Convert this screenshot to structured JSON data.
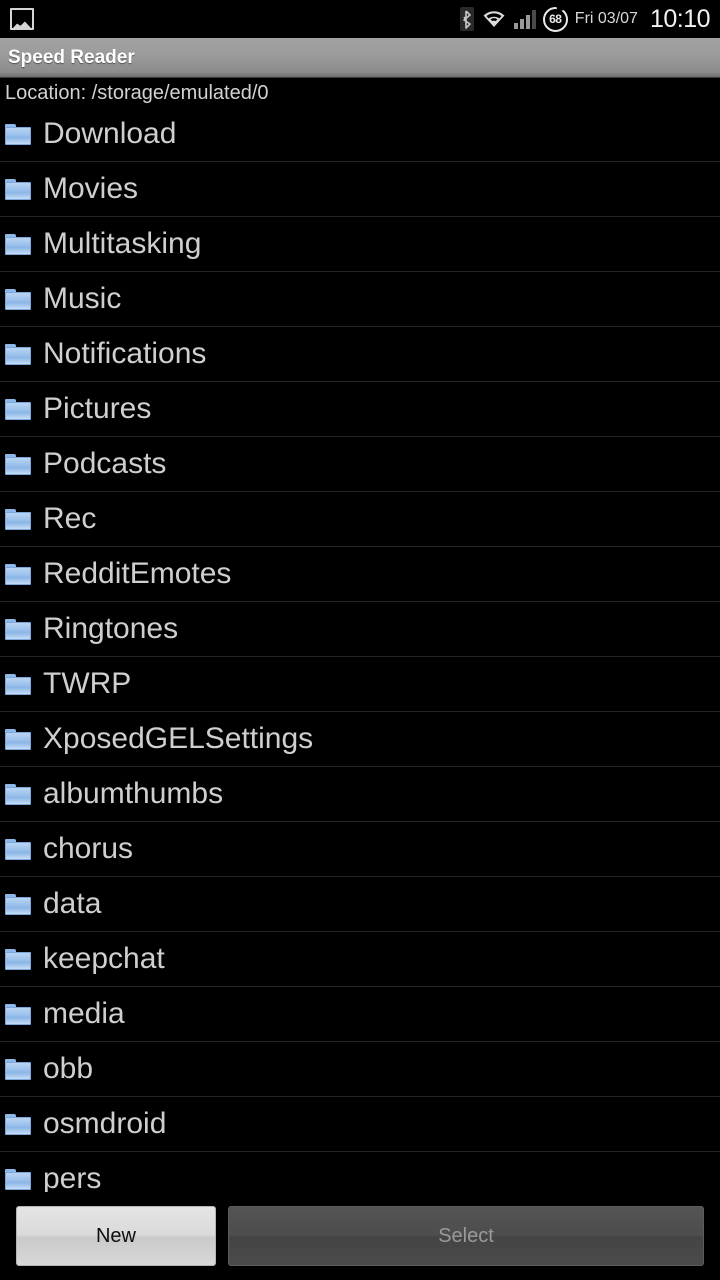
{
  "status_bar": {
    "notification_icon": "image-icon",
    "bluetooth_icon": "bluetooth-icon",
    "wifi_icon": "wifi-icon",
    "signal_icon": "cell-signal-icon",
    "battery_level": "68",
    "date": "Fri 03/07",
    "time": "10:10"
  },
  "title_bar": {
    "app_title": "Speed Reader"
  },
  "location": {
    "text": "Location: /storage/emulated/0"
  },
  "file_list": {
    "items": [
      {
        "name": "Download",
        "icon": "folder-icon"
      },
      {
        "name": "Movies",
        "icon": "folder-icon"
      },
      {
        "name": "Multitasking",
        "icon": "folder-icon"
      },
      {
        "name": "Music",
        "icon": "folder-icon"
      },
      {
        "name": "Notifications",
        "icon": "folder-icon"
      },
      {
        "name": "Pictures",
        "icon": "folder-icon"
      },
      {
        "name": "Podcasts",
        "icon": "folder-icon"
      },
      {
        "name": "Rec",
        "icon": "folder-icon"
      },
      {
        "name": "RedditEmotes",
        "icon": "folder-icon"
      },
      {
        "name": "Ringtones",
        "icon": "folder-icon"
      },
      {
        "name": "TWRP",
        "icon": "folder-icon"
      },
      {
        "name": "XposedGELSettings",
        "icon": "folder-icon"
      },
      {
        "name": "albumthumbs",
        "icon": "folder-icon"
      },
      {
        "name": "chorus",
        "icon": "folder-icon"
      },
      {
        "name": "data",
        "icon": "folder-icon"
      },
      {
        "name": "keepchat",
        "icon": "folder-icon"
      },
      {
        "name": "media",
        "icon": "folder-icon"
      },
      {
        "name": "obb",
        "icon": "folder-icon"
      },
      {
        "name": "osmdroid",
        "icon": "folder-icon"
      },
      {
        "name": "pers",
        "icon": "folder-icon"
      }
    ]
  },
  "buttons": {
    "new_label": "New",
    "select_label": "Select"
  },
  "colors": {
    "background": "#000000",
    "list_text": "#cfcfcf",
    "folder_blue": "#9cc2ec",
    "title_bar_gray": "#9b9b9b",
    "divider": "#242424",
    "new_button_bg": "#dadada",
    "select_button_bg": "#4d4d4d"
  }
}
